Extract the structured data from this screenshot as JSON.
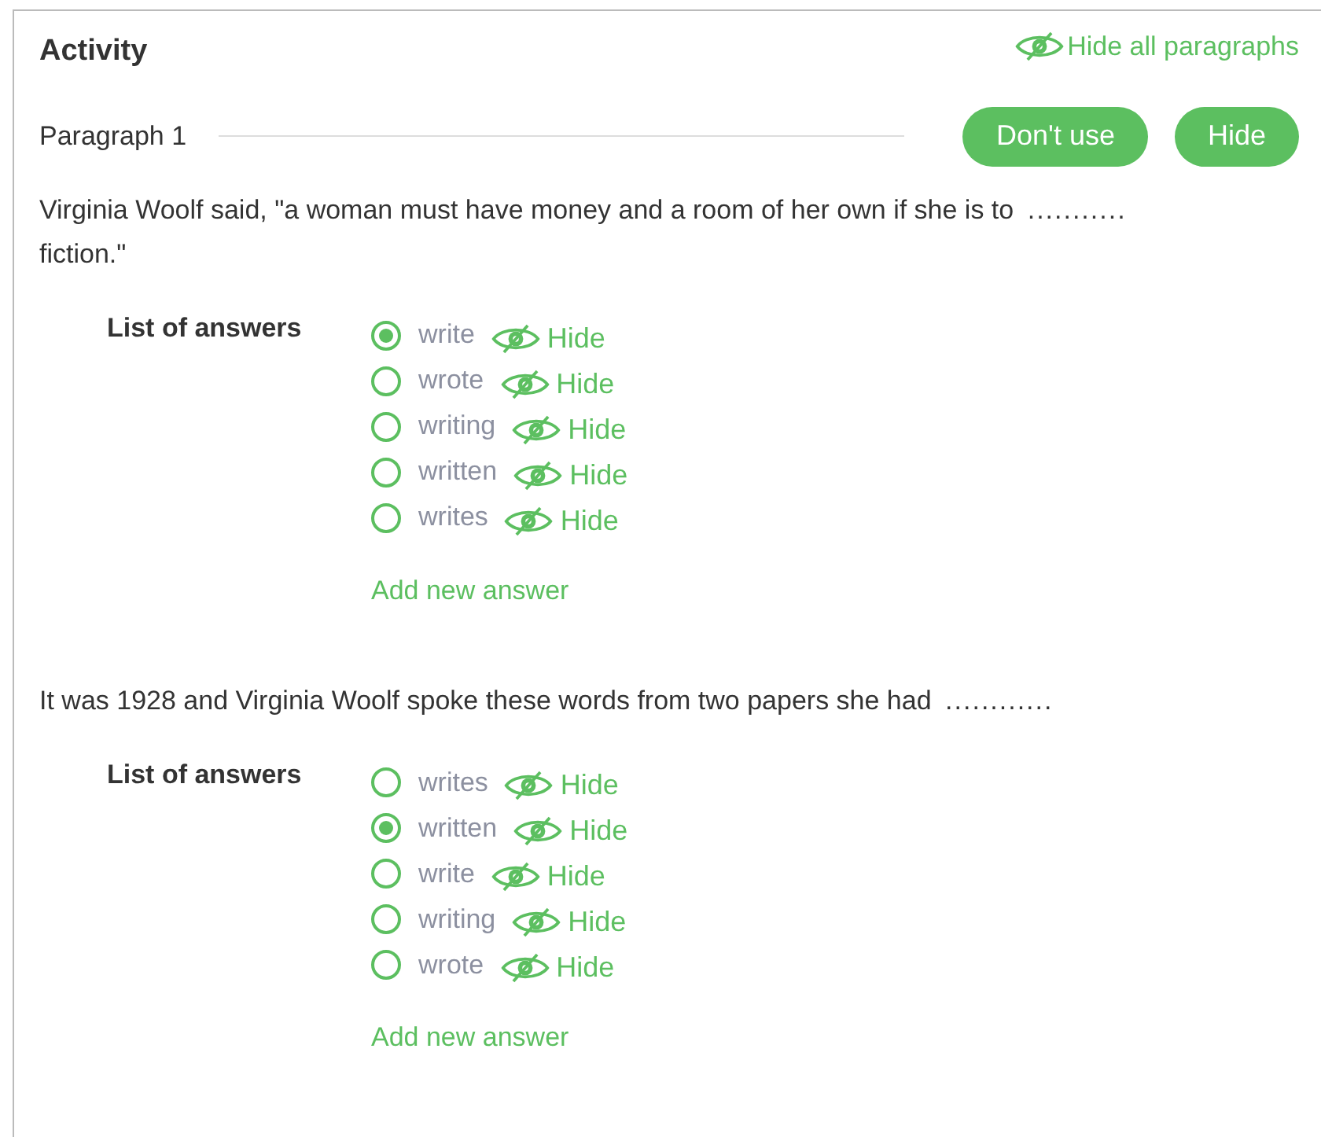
{
  "title": "Activity",
  "hide_all": "Hide all paragraphs",
  "paragraphs": [
    {
      "heading": "Paragraph 1",
      "buttons": [
        "Don't use",
        "Hide"
      ],
      "text": "Virginia Woolf said, \"a woman must have money and a room of her own if she is to",
      "blank": "...........",
      "text_after": "fiction.\"",
      "answers_label": "List of answers",
      "answers": [
        {
          "text": "write",
          "selected": true,
          "hide": "Hide"
        },
        {
          "text": "wrote",
          "selected": false,
          "hide": "Hide"
        },
        {
          "text": "writing",
          "selected": false,
          "hide": "Hide"
        },
        {
          "text": "written",
          "selected": false,
          "hide": "Hide"
        },
        {
          "text": "writes",
          "selected": false,
          "hide": "Hide"
        }
      ],
      "add": "Add new answer"
    },
    {
      "text": "It was 1928 and Virginia Woolf spoke these words from two papers she had",
      "blank": "............",
      "answers_label": "List of answers",
      "answers": [
        {
          "text": "writes",
          "selected": false,
          "hide": "Hide"
        },
        {
          "text": "written",
          "selected": true,
          "hide": "Hide"
        },
        {
          "text": "write",
          "selected": false,
          "hide": "Hide"
        },
        {
          "text": "writing",
          "selected": false,
          "hide": "Hide"
        },
        {
          "text": "wrote",
          "selected": false,
          "hide": "Hide"
        }
      ],
      "add": "Add new answer"
    }
  ]
}
